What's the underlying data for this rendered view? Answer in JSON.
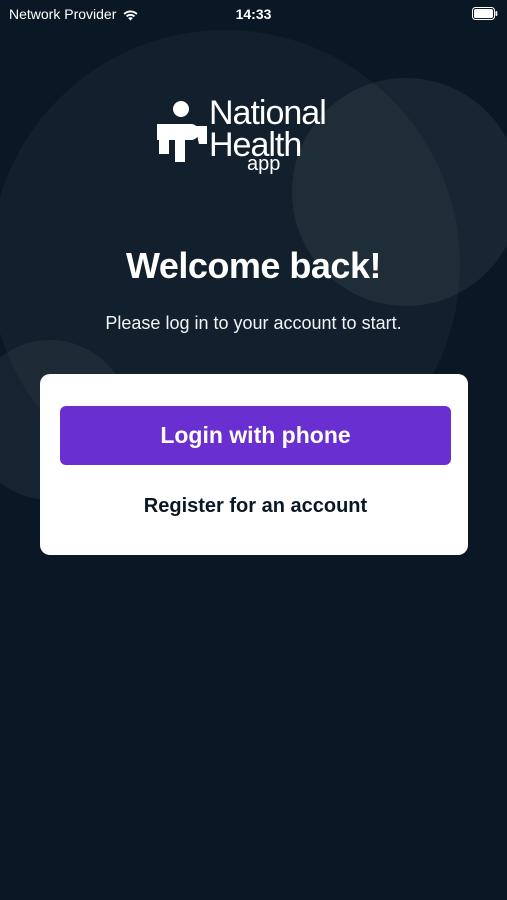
{
  "status_bar": {
    "carrier": "Network Provider",
    "wifi_icon": "wifi-icon",
    "time": "14:33",
    "battery_icon": "battery-icon"
  },
  "logo": {
    "line1": "National",
    "line2": "Health",
    "line3": "app",
    "mark_icon": "national-health-mark-icon"
  },
  "welcome": {
    "title": "Welcome back!",
    "subtitle": "Please log in to your account to start."
  },
  "actions": {
    "login_label": "Login with phone",
    "register_label": "Register for an account"
  },
  "colors": {
    "background": "#0a1826",
    "primary_button": "#6a2fd0",
    "card": "#ffffff",
    "secondary_text": "#0a1826"
  }
}
